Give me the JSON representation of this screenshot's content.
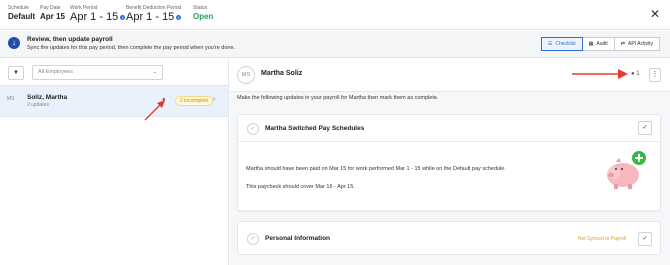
{
  "header": {
    "fields": [
      {
        "label": "Schedule",
        "value": "Default"
      },
      {
        "label": "Pay Date",
        "value": "Apr 15"
      },
      {
        "label": "Work Period",
        "value": "Apr 1 - 15"
      },
      {
        "label": "Benefit Deduction Period",
        "value": "Apr 1 - 15"
      },
      {
        "label": "Status",
        "value": "Open"
      }
    ],
    "close_glyph": "✕",
    "info_glyph": "i",
    "status_color": "#27a35a"
  },
  "banner": {
    "title": "Review, then update payroll",
    "subtitle": "Sync the updates for this pay period, then complete the pay period when you're done.",
    "icon": "down-arrow-circle-icon",
    "icon_glyph": "↓",
    "tabs": [
      {
        "label": "Checklist",
        "icon": "checklist-icon",
        "glyph": "☰",
        "active": true
      },
      {
        "label": "Audit",
        "icon": "audit-icon",
        "glyph": "▦",
        "active": false
      },
      {
        "label": "API Activity",
        "icon": "api-icon",
        "glyph": "⇄",
        "active": false
      }
    ]
  },
  "left": {
    "filter_glyph": "▼",
    "employee_select": {
      "placeholder": "All Employees",
      "chevron": "⌄"
    },
    "employees": [
      {
        "initials": "MS",
        "name": "Soliz, Martha",
        "sub": "2 updates",
        "comment_glyph": "●",
        "badge": "2 incomplete",
        "chevron": "›"
      }
    ]
  },
  "detail": {
    "initials": "MS",
    "name": "Martha Soliz",
    "comment_count": "1",
    "comment_glyph": "●",
    "kebab_glyph": "⋮",
    "intro": "Make the following updates in your payroll for Martha then mark them as complete.",
    "cards": [
      {
        "title": "Martha Switched Pay Schedules",
        "check_glyph": "✓",
        "done_glyph": "✓",
        "body": [
          "Martha should have been paid on Mar 15 for work performed Mar 1 - 15 while on the Default pay schedule.",
          "This paycheck should cover Mar 16 - Apr 15."
        ]
      },
      {
        "title": "Personal Information",
        "check_glyph": "✓",
        "done_glyph": "✓",
        "status": "Not Synced to Payroll",
        "status_color": "#e2a21a"
      }
    ]
  },
  "colors": {
    "accent": "#2d6fd2",
    "annotation_arrow": "#e53b2c",
    "pig_body": "#f6b8bf",
    "plus_badge": "#3bb54a"
  }
}
